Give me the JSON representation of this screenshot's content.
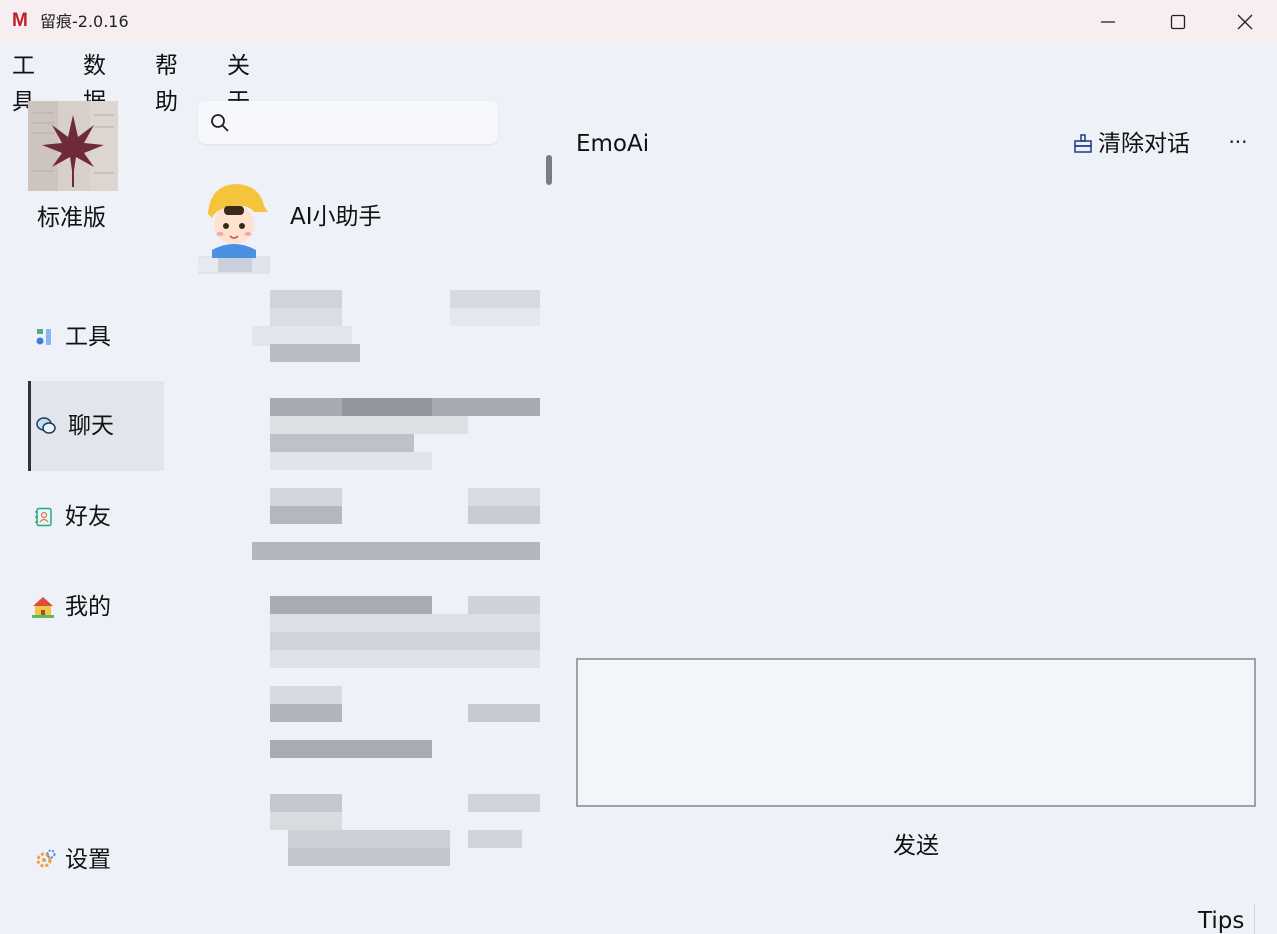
{
  "window": {
    "logo_letter": "M",
    "title": "留痕-2.0.16",
    "colors": {
      "titlebar": "#f7eef1",
      "background": "#eef2f8",
      "logo": "#c0202a"
    }
  },
  "menu": {
    "items": [
      "工具",
      "数据",
      "帮助",
      "关于"
    ]
  },
  "nav": {
    "edition": "标准版",
    "items": [
      {
        "label": "工具",
        "icon": "tools-icon"
      },
      {
        "label": "聊天",
        "icon": "chat-bubbles-icon",
        "active": true
      },
      {
        "label": "好友",
        "icon": "contacts-book-icon"
      },
      {
        "label": "我的",
        "icon": "house-icon"
      }
    ],
    "settings_label": "设置"
  },
  "search": {
    "placeholder": "",
    "value": ""
  },
  "contacts": {
    "first": {
      "name": "AI小助手",
      "avatar": "cartoon-boy-yellow-cap"
    }
  },
  "chat": {
    "title": "EmoAi",
    "clear_label": "清除对话",
    "more_label": "···",
    "input_value": "",
    "send_label": "发送",
    "tips_label": "Tips"
  }
}
